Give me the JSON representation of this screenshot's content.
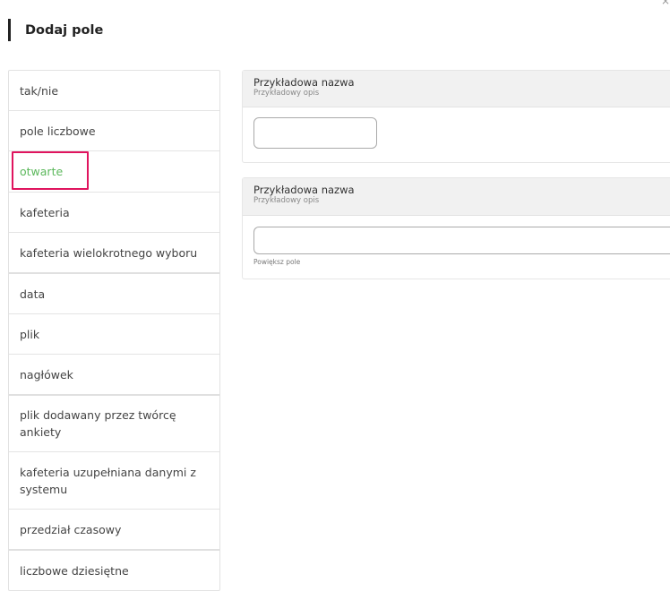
{
  "header": {
    "title": "Dodaj pole"
  },
  "sidebar": {
    "items": [
      {
        "label": "tak/nie"
      },
      {
        "label": "pole liczbowe"
      },
      {
        "label": "otwarte"
      },
      {
        "label": "kafeteria"
      },
      {
        "label": "kafeteria wielokrotnego wyboru"
      },
      {
        "label": "data"
      },
      {
        "label": "plik"
      },
      {
        "label": "nagłówek"
      },
      {
        "label": "plik dodawany przez twórcę ankiety"
      },
      {
        "label": "kafeteria uzupełniana danymi z systemu"
      },
      {
        "label": "przedział czasowy"
      },
      {
        "label": "liczbowe dziesiętne"
      }
    ],
    "selected": "otwarte",
    "accent_color": "#5cb85c",
    "highlight_color": "#e0145e"
  },
  "preview": {
    "short_field": {
      "title": "Przykładowa nazwa",
      "description": "Przykładowy opis",
      "value": ""
    },
    "long_field": {
      "title": "Przykładowa nazwa",
      "description": "Przykładowy opis",
      "value": "",
      "enlarge_label": "Powiększ pole"
    }
  }
}
